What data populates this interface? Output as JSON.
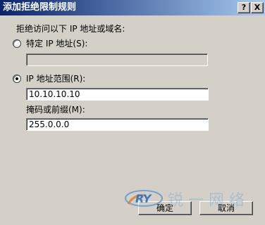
{
  "window": {
    "title": "添加拒绝限制规则",
    "help_label": "?",
    "close_label": "X"
  },
  "form": {
    "prompt": "拒绝访问以下 IP 地址或域名:",
    "option_single_ip": {
      "label": "特定 IP 地址(S):",
      "selected": false,
      "value": ""
    },
    "option_ip_range": {
      "label": "IP 地址范围(R):",
      "selected": true,
      "value": "10.10.10.10"
    },
    "mask_label": "掩码或前缀(M):",
    "mask_value": "255.0.0.0"
  },
  "buttons": {
    "ok_label": "确定",
    "cancel_label": "取消"
  },
  "watermark": {
    "logo_text": "RY",
    "text": "锐 一 网 络"
  }
}
